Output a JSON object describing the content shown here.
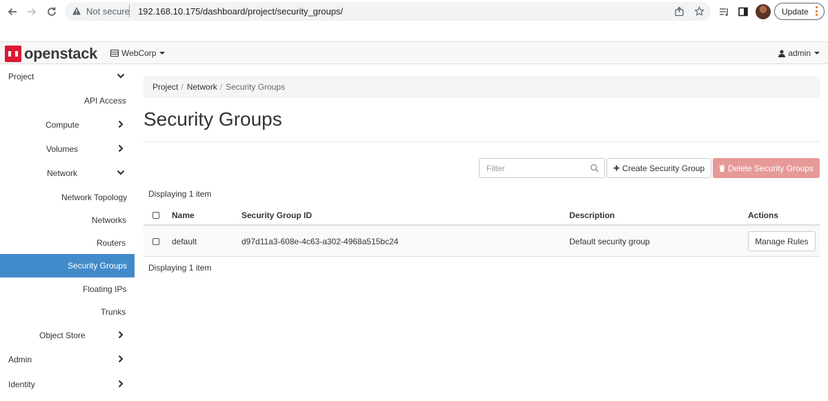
{
  "browser": {
    "security_label": "Not secure",
    "url": "192.168.10.175/dashboard/project/security_groups/",
    "update_label": "Update"
  },
  "header": {
    "brand": "openstack",
    "project": "WebCorp",
    "user": "admin"
  },
  "sidebar": {
    "items": [
      {
        "label": "Project"
      },
      {
        "label": "API Access"
      },
      {
        "label": "Compute"
      },
      {
        "label": "Volumes"
      },
      {
        "label": "Network"
      },
      {
        "label": "Network Topology"
      },
      {
        "label": "Networks"
      },
      {
        "label": "Routers"
      },
      {
        "label": "Security Groups"
      },
      {
        "label": "Floating IPs"
      },
      {
        "label": "Trunks"
      },
      {
        "label": "Object Store"
      },
      {
        "label": "Admin"
      },
      {
        "label": "Identity"
      }
    ]
  },
  "breadcrumb": {
    "items": [
      "Project",
      "Network",
      "Security Groups"
    ],
    "separator": "/"
  },
  "page": {
    "title": "Security Groups"
  },
  "actions": {
    "filter_placeholder": "Filter",
    "create_label": "Create Security Group",
    "delete_label": "Delete Security Groups"
  },
  "table": {
    "count_label": "Displaying 1 item",
    "columns": [
      "Name",
      "Security Group ID",
      "Description",
      "Actions"
    ],
    "rows": [
      {
        "name": "default",
        "id": "d97d11a3-608e-4c63-a302-4968a515bc24",
        "description": "Default security group",
        "action_label": "Manage Rules"
      }
    ]
  },
  "colors": {
    "accent": "#428bca",
    "danger_disabled": "#e69a98",
    "brand_red": "#da1a32"
  }
}
